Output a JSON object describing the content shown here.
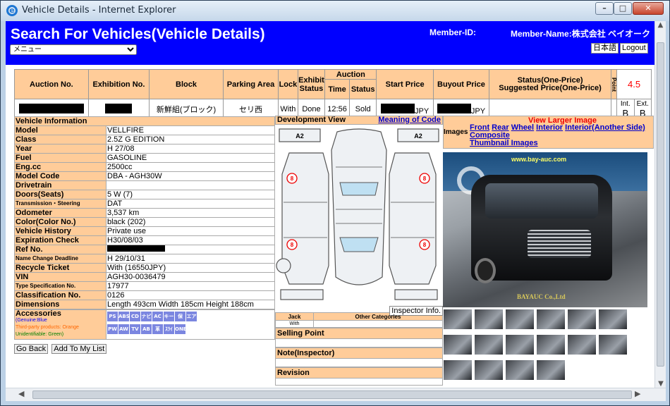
{
  "window": {
    "title": "Vehicle Details - Internet Explorer"
  },
  "header": {
    "title": "Search For Vehicles(Vehicle Details)",
    "member_id_label": "Member-ID:",
    "member_name_label": "Member-Name:株式会社 ベイオーク",
    "menu_select": "メニュー",
    "lang_button": "日本語",
    "logout_button": "Logout"
  },
  "auction_table": {
    "headers": [
      "Auction No.",
      "Exhibition No.",
      "Block",
      "Parking Area",
      "Lock",
      "Exhibit Status",
      "Auction",
      "Start Price",
      "Buyout Price",
      "Status(One-Price)",
      "Suggested Price(One-Price)",
      "Point"
    ],
    "auction_sub": [
      "Time",
      "Status"
    ],
    "block": "新鮮組(ブロック)",
    "parking_area": "セリ西",
    "lock": "With",
    "exhibit_status": "Done",
    "time": "12:56",
    "status": "Sold",
    "currency": "JPY",
    "point": "4.5",
    "int_label": "Int.",
    "int_grade": "B",
    "ext_label": "Ext.",
    "ext_grade": "B"
  },
  "vehicle_info": {
    "title": "Vehicle Information",
    "rows": [
      {
        "k": "Model",
        "v": "VELLFIRE"
      },
      {
        "k": "Class",
        "v": "2.5Z G EDITION"
      },
      {
        "k": "Year",
        "v": "H 27/08"
      },
      {
        "k": "Fuel",
        "v": "GASOLINE"
      },
      {
        "k": "Eng.cc",
        "v": "2500cc"
      },
      {
        "k": "Model Code",
        "v": "DBA - AGH30W"
      },
      {
        "k": "Drivetrain",
        "v": ""
      },
      {
        "k": "Doors(Seats)",
        "v": "5 W (7)"
      },
      {
        "k": "Transmission・Steering",
        "v": "DAT"
      },
      {
        "k": "Odometer",
        "v": "3,537 km"
      },
      {
        "k": "Color(Color No.)",
        "v": "black (202)"
      },
      {
        "k": "Vehicle History",
        "v": "Private use"
      },
      {
        "k": "Expiration Check",
        "v": "H30/08/03"
      },
      {
        "k": "Ref No.",
        "v": ""
      },
      {
        "k": "Name Change Deadline",
        "v": "H 29/10/31"
      },
      {
        "k": "Recycle Ticket",
        "v": "With (16550JPY)"
      },
      {
        "k": "VIN",
        "v": "AGH30-0036479"
      },
      {
        "k": "Type Specification No.",
        "v": "17977"
      },
      {
        "k": "Classification No.",
        "v": "0126"
      },
      {
        "k": "Dimensions",
        "v": "Length 493cm  Width 185cm  Height 188cm"
      }
    ],
    "accessories_label": "Accessories",
    "acc_genuine": "(Genuine:Blue",
    "acc_third": "Third-party products: Orange",
    "acc_unknown": "Unidentifiable: Green)",
    "acc_badges": [
      "PS",
      "ABS",
      "CD",
      "ナビ",
      "AC",
      "キーレス",
      "保",
      "エアバッグ",
      "PW",
      "AW",
      "TV",
      "AB",
      "革",
      "ｽﾗｲﾄﾞ",
      "ONE"
    ],
    "go_back": "Go Back",
    "add_list": "Add To My List"
  },
  "development": {
    "title": "Development View",
    "meaning": "Meaning of Code",
    "a2_left": "A2",
    "a2_right": "A2",
    "marks": [
      "8",
      "8",
      "8",
      "8"
    ],
    "inspector_info": "Inspector Info.",
    "jack": "Jack",
    "jack_val": "With",
    "other_categories": "Other Categories",
    "selling_point": "Selling Point",
    "note": "Note(Inspector)",
    "revision": "Revision"
  },
  "images": {
    "label": "Images",
    "view_larger": "View Larger Image",
    "links": [
      "Front",
      "Rear",
      "Wheel",
      "Interior",
      "Interior(Another Side)",
      "Composite",
      "Thumbnail Images"
    ],
    "watermark_url": "www.bay-auc.com",
    "watermark_company": "BAYAUC Co.,Ltd"
  },
  "colors": {
    "header_blue": "#0000ff",
    "label_orange": "#ffcc99",
    "point_red": "#ff0000"
  }
}
